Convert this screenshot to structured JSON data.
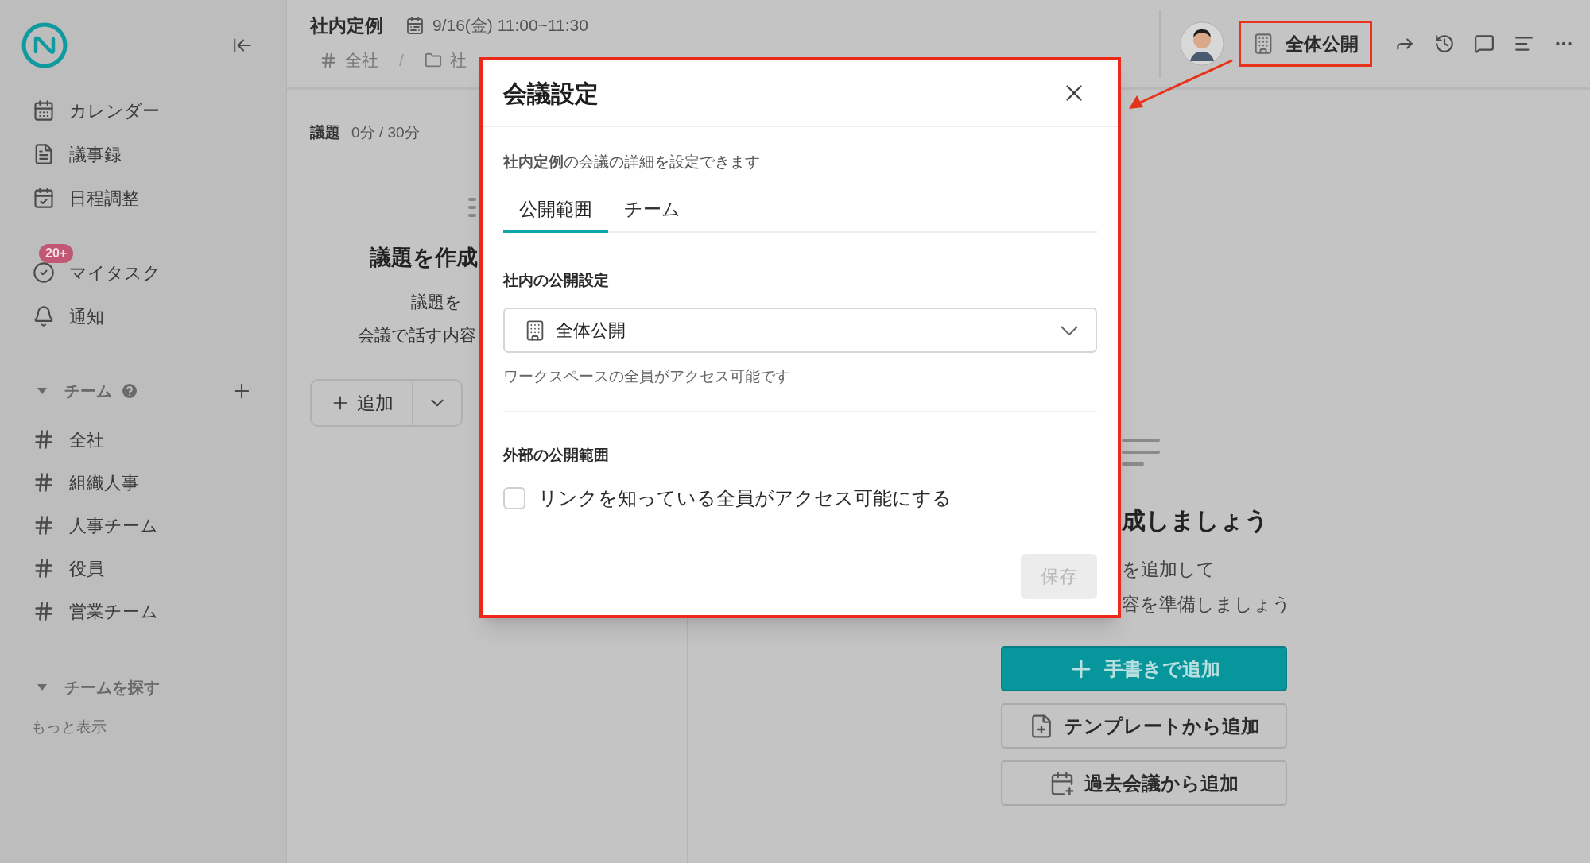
{
  "sidebar": {
    "nav": [
      {
        "label": "カレンダー",
        "kind": "calendar"
      },
      {
        "label": "議事録",
        "kind": "notes"
      },
      {
        "label": "日程調整",
        "kind": "schedule"
      }
    ],
    "personal": [
      {
        "label": "マイタスク",
        "kind": "tasks",
        "badge": "20+"
      },
      {
        "label": "通知",
        "kind": "bell"
      }
    ],
    "teams": {
      "label": "チーム",
      "expanded": true,
      "items": [
        {
          "label": "全社"
        },
        {
          "label": "組織人事"
        },
        {
          "label": "人事チーム"
        },
        {
          "label": "役員"
        },
        {
          "label": "営業チーム"
        }
      ]
    },
    "find_teams": {
      "label": "チームを探す",
      "expanded": true
    },
    "more": "もっと表示"
  },
  "header": {
    "title": "社内定例",
    "datetime": "9/16(金) 11:00~11:30",
    "breadcrumb": [
      {
        "label": "全社",
        "kind": "channel"
      },
      {
        "label": "社",
        "kind": "folder"
      }
    ],
    "separator": "/",
    "visibility": "全体公開"
  },
  "agenda": {
    "label": "議題",
    "time": "0分 / 30分",
    "empty_title": "議題を作成",
    "empty_lines": [
      "議題を",
      "会議で話す内容"
    ],
    "add": "追加"
  },
  "minutes": {
    "empty_title": "成しましょう",
    "empty_lines": [
      "を追加して",
      "容を準備しましょう"
    ],
    "buttons": [
      {
        "label": "手書きで追加",
        "kind": "primary"
      },
      {
        "label": "テンプレートから追加",
        "kind": "template"
      },
      {
        "label": "過去会議から追加",
        "kind": "past"
      }
    ]
  },
  "dialog": {
    "title": "会議設定",
    "description": "**社内定例**の会議の詳細を設定できます",
    "tabs": [
      {
        "label": "公開範囲",
        "selected": true
      },
      {
        "label": "チーム",
        "selected": false
      }
    ],
    "internal": {
      "label": "社内の公開設定",
      "value": "全体公開",
      "helper": "ワークスペースの全員がアクセス可能です"
    },
    "external": {
      "label": "外部の公開範囲",
      "checkbox": {
        "label": "リンクを知っている全員がアクセス可能にする",
        "checked": false
      }
    },
    "save": {
      "label": "保存",
      "disabled": true
    }
  }
}
